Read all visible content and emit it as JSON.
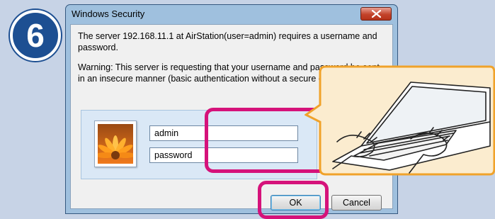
{
  "step": {
    "number": "6"
  },
  "dialog": {
    "title": "Windows Security",
    "message": "The server 192.168.11.1 at AirStation(user=admin) requires a username and password.",
    "warning": "Warning: This server is requesting that your username and password be sent in an insecure manner (basic authentication without a secure connection).",
    "username_value": "admin",
    "password_value": "password",
    "ok_label": "OK",
    "cancel_label": "Cancel"
  },
  "colors": {
    "background": "#c7d3e6",
    "step_badge": "#1d4f92",
    "highlight": "#d5127a",
    "callout_border": "#f0a22a",
    "callout_fill": "#fbeccf"
  },
  "illustration": {
    "icon": "laptop-typing-icon"
  }
}
